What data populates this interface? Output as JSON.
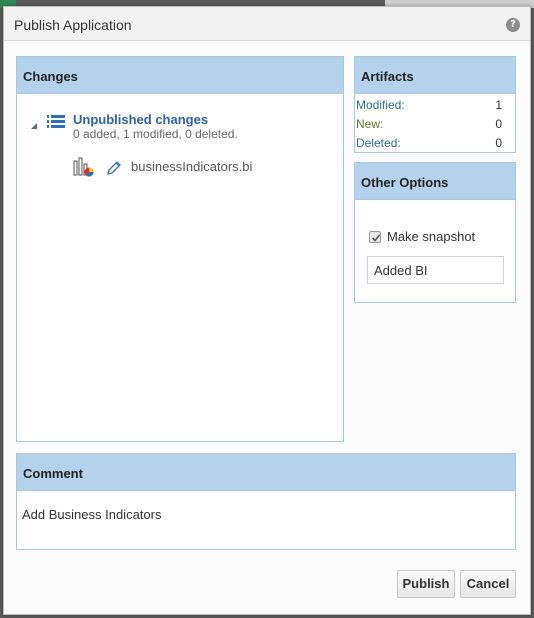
{
  "dialog": {
    "title": "Publish Application",
    "help_icon": "?"
  },
  "changes": {
    "header": "Changes",
    "node": {
      "title": "Unpublished changes",
      "summary": "0 added, 1 modified, 0 deleted."
    },
    "file": {
      "name": "businessIndicators.bi",
      "status_icon": "pencil-icon",
      "type_icon": "chart-icon"
    }
  },
  "artifacts": {
    "header": "Artifacts",
    "rows": [
      {
        "label": "Modified:",
        "value": "1",
        "color": "#2f6f8a"
      },
      {
        "label": "New:",
        "value": "0",
        "color": "#5c7a2e"
      },
      {
        "label": "Deleted:",
        "value": "0",
        "color": "#2f6f8a"
      }
    ]
  },
  "options": {
    "header": "Other Options",
    "snapshot_label": "Make snapshot",
    "snapshot_checked": true,
    "snapshot_value": "Added BI"
  },
  "comment": {
    "header": "Comment",
    "text": "Add Business Indicators"
  },
  "buttons": {
    "publish": "Publish",
    "cancel": "Cancel"
  }
}
